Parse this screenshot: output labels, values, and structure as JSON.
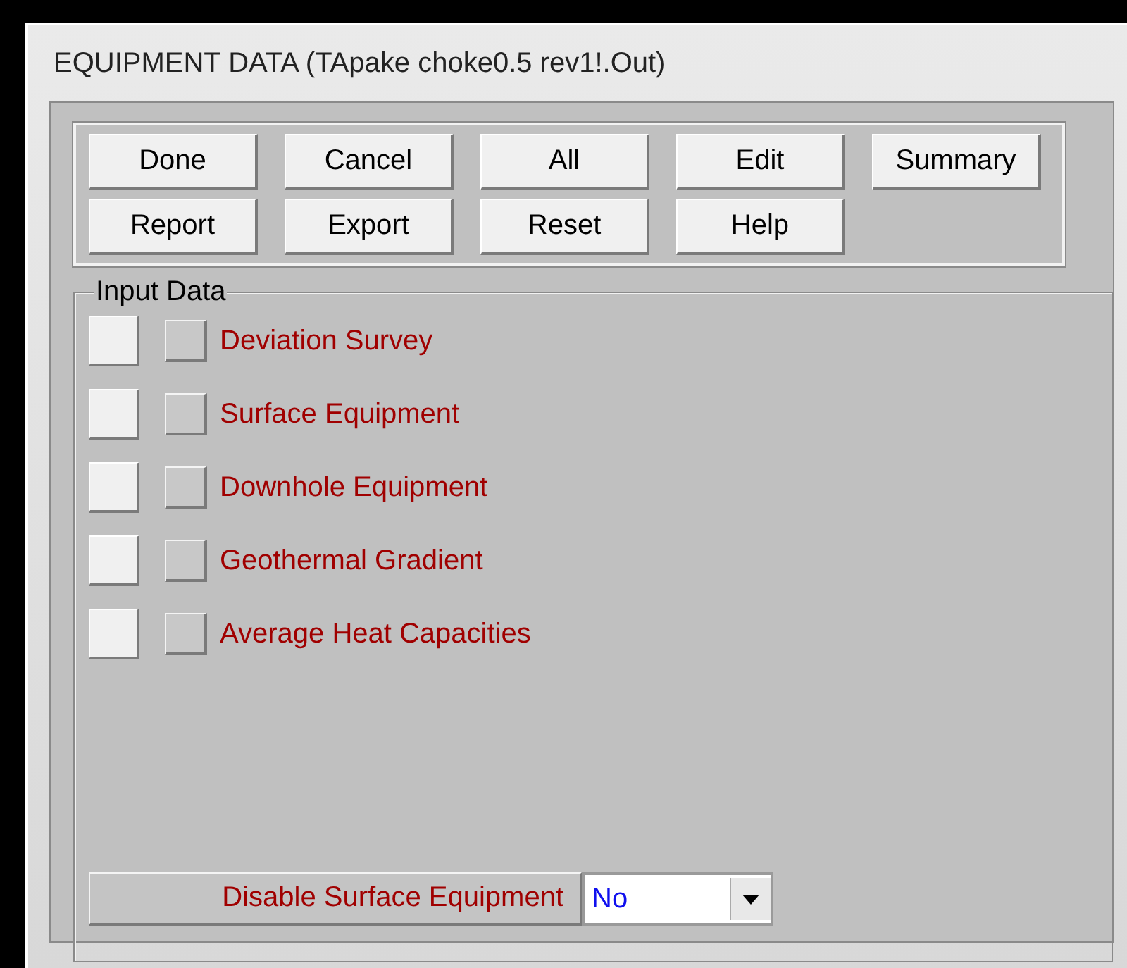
{
  "window": {
    "title": "EQUIPMENT DATA (TApake choke0.5 rev1!.Out)"
  },
  "buttons": [
    [
      "Done",
      "Cancel",
      "All",
      "Edit",
      "Summary"
    ],
    [
      "Report",
      "Export",
      "Reset",
      "Help"
    ]
  ],
  "input_data": {
    "title": "Input Data",
    "items": [
      {
        "label": "Deviation Survey"
      },
      {
        "label": "Surface Equipment"
      },
      {
        "label": "Downhole Equipment"
      },
      {
        "label": "Geothermal Gradient"
      },
      {
        "label": "Average Heat Capacities"
      }
    ]
  },
  "disable_surface_equipment": {
    "label": "Disable Surface Equipment",
    "value": "No"
  }
}
